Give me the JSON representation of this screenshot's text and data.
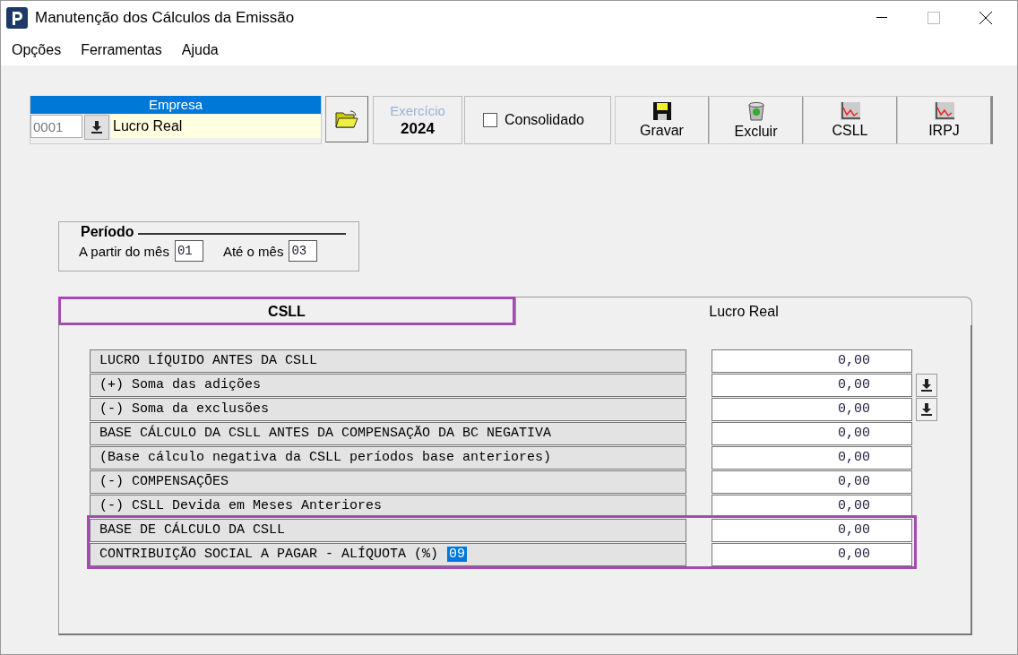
{
  "window": {
    "title": "Manutenção dos Cálculos da Emissão"
  },
  "menu": [
    "Opções",
    "Ferramentas",
    "Ajuda"
  ],
  "empresa": {
    "label": "Empresa",
    "code": "0001",
    "name": "Lucro Real"
  },
  "exercicio": {
    "label": "Exercício",
    "value": "2024"
  },
  "consolidado": {
    "label": "Consolidado",
    "checked": false
  },
  "toolbar": [
    {
      "label": "Gravar",
      "kind": "save"
    },
    {
      "label": "Excluir",
      "kind": "delete"
    },
    {
      "label": "CSLL",
      "kind": "report"
    },
    {
      "label": "IRPJ",
      "kind": "report"
    }
  ],
  "periodo": {
    "title": "Período",
    "from_label": "A partir do mês",
    "from": "01",
    "to_label": "Até o mês",
    "to": "03"
  },
  "tabs": [
    {
      "label": "CSLL",
      "selected": true,
      "highlighted": true
    },
    {
      "label": "Lucro Real",
      "selected": false,
      "highlighted": false
    }
  ],
  "rows": [
    {
      "label": "LUCRO LÍQUIDO ANTES DA CSLL",
      "value": "0,00",
      "dropdown": false,
      "highlighted": false
    },
    {
      "label": "(+) Soma das adições",
      "value": "0,00",
      "dropdown": true,
      "highlighted": false
    },
    {
      "label": "(-) Soma da exclusões",
      "value": "0,00",
      "dropdown": true,
      "highlighted": false
    },
    {
      "label": "BASE CÁLCULO DA CSLL ANTES DA COMPENSAÇÃO DA BC NEGATIVA",
      "value": "0,00",
      "dropdown": false,
      "highlighted": false
    },
    {
      "label": "(Base cálculo negativa da CSLL períodos base anteriores)",
      "value": "0,00",
      "dropdown": false,
      "highlighted": false
    },
    {
      "label": "(-) COMPENSAÇÕES",
      "value": "0,00",
      "dropdown": false,
      "highlighted": false
    },
    {
      "label": "(-) CSLL Devida em Meses Anteriores",
      "value": "0,00",
      "dropdown": false,
      "highlighted": false
    },
    {
      "label": "BASE DE CÁLCULO DA CSLL",
      "value": "0,00",
      "dropdown": false,
      "highlighted": true
    },
    {
      "label": "CONTRIBUIÇÃO SOCIAL A PAGAR - ALÍQUOTA (%)",
      "rate": "09",
      "value": "0,00",
      "dropdown": false,
      "highlighted": true
    }
  ]
}
